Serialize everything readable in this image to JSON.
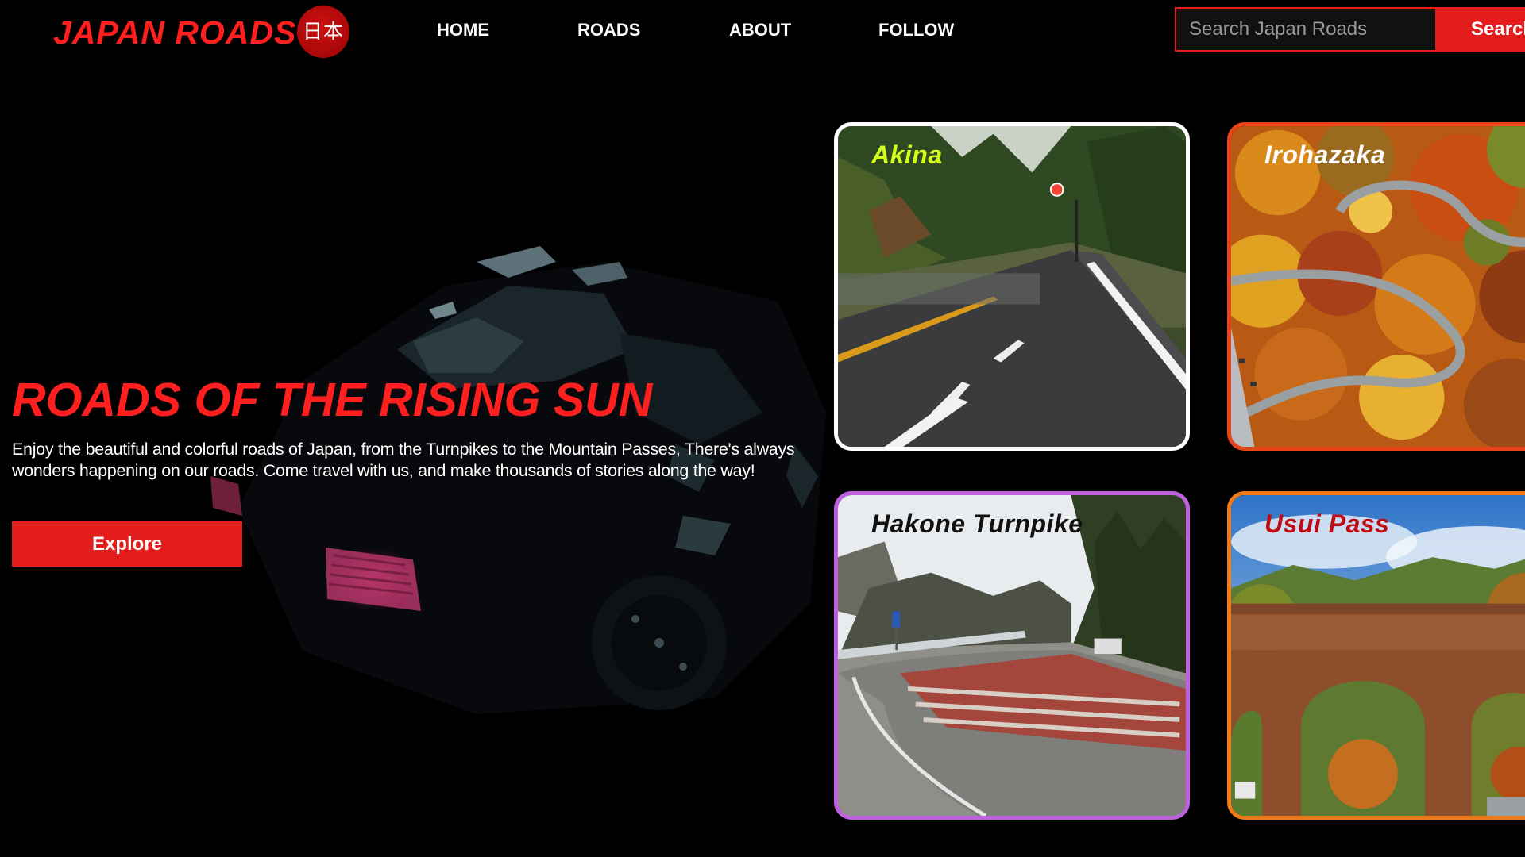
{
  "header": {
    "logo_text": "JAPAN ROADS",
    "logo_badge": "日本",
    "nav": [
      {
        "label": "HOME"
      },
      {
        "label": "ROADS"
      },
      {
        "label": "ABOUT"
      },
      {
        "label": "FOLLOW"
      }
    ],
    "search": {
      "placeholder": "Search Japan Roads",
      "button_label": "Search"
    }
  },
  "hero": {
    "title": "ROADS OF THE RISING SUN",
    "description": "Enjoy the beautiful and colorful roads of Japan, from the Turnpikes to the Mountain Passes, There's always wonders happening on our roads. Come travel with us, and make thousands of stories along the way!",
    "cta_label": "Explore"
  },
  "cards": [
    {
      "name": "Akina",
      "border_color": "#ffffff",
      "title_color": "#d4ff1a",
      "image": "mountain-road-photo"
    },
    {
      "name": "Irohazaka",
      "border_color": "#e8441a",
      "title_color": "#ffffff",
      "image": "autumn-switchback-aerial-photo"
    },
    {
      "name": "Hakone Turnpike",
      "border_color": "#c060e0",
      "title_color": "#111111",
      "image": "turnpike-curve-photo"
    },
    {
      "name": "Usui Pass",
      "border_color": "#f07a18",
      "title_color": "#c00a14",
      "image": "brick-arch-bridge-photo"
    }
  ],
  "colors": {
    "accent": "#e31c1c",
    "background": "#000000"
  }
}
